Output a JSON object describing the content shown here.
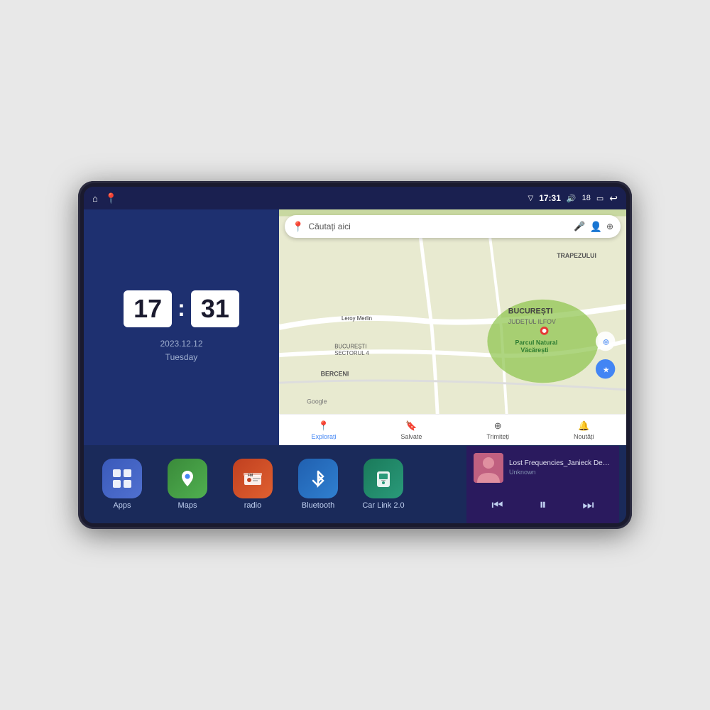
{
  "device": {
    "status_bar": {
      "left_icons": [
        "home-icon",
        "maps-pin-icon"
      ],
      "signal_icon": "▽",
      "time": "17:31",
      "volume_icon": "🔊",
      "battery_level": "18",
      "battery_icon": "🔋",
      "back_icon": "↩"
    },
    "clock": {
      "hours": "17",
      "minutes": "31",
      "date": "2023.12.12",
      "day": "Tuesday"
    },
    "map": {
      "search_placeholder": "Căutați aici",
      "location_name": "Parcul Natural Văcărești",
      "area_label": "BUCUREȘTI",
      "sub_label": "JUDEȚUL ILFOV",
      "district": "TRAPEZULUI",
      "berceni": "BERCENI",
      "leroy": "Leroy Merlin",
      "sector4": "BUCUREȘTI\nSECTORUL 4",
      "nav_items": [
        {
          "label": "Explorați",
          "icon": "📍",
          "active": true
        },
        {
          "label": "Salvate",
          "icon": "🔖",
          "active": false
        },
        {
          "label": "Trimiteți",
          "icon": "⊕",
          "active": false
        },
        {
          "label": "Noutăți",
          "icon": "🔔",
          "active": false
        }
      ]
    },
    "apps": [
      {
        "id": "apps",
        "label": "Apps",
        "icon": "⊞",
        "color_class": "icon-apps"
      },
      {
        "id": "maps",
        "label": "Maps",
        "icon": "🗺",
        "color_class": "icon-maps"
      },
      {
        "id": "radio",
        "label": "radio",
        "icon": "📻",
        "color_class": "icon-radio"
      },
      {
        "id": "bluetooth",
        "label": "Bluetooth",
        "icon": "🔵",
        "color_class": "icon-bluetooth"
      },
      {
        "id": "carlink",
        "label": "Car Link 2.0",
        "icon": "📱",
        "color_class": "icon-carlink"
      }
    ],
    "music": {
      "title": "Lost Frequencies_Janieck Devy-...",
      "artist": "Unknown",
      "thumb_emoji": "🎵",
      "controls": {
        "prev": "⏮",
        "play": "⏸",
        "next": "⏭"
      }
    }
  }
}
